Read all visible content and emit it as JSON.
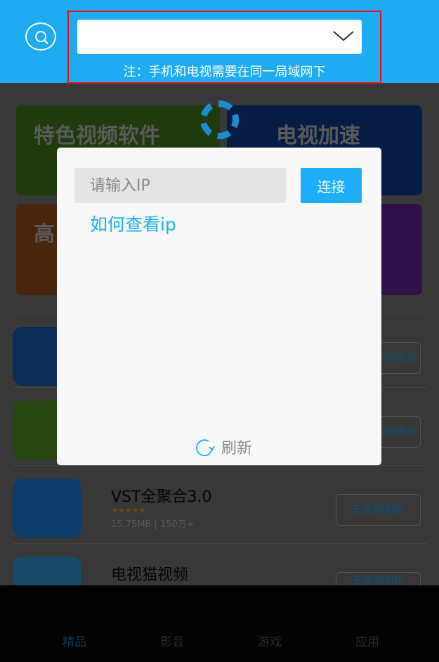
{
  "header": {
    "note": "注：手机和电视需要在同一局域网下",
    "device_select_value": "",
    "icons": {
      "search": "search-icon",
      "dropdown": "chevron-down-icon"
    }
  },
  "banners": [
    {
      "title": "特色视频软件"
    },
    {
      "title": "电视加速"
    },
    {
      "title": "高"
    },
    {
      "title": ""
    }
  ],
  "apps": [
    {
      "name": "",
      "install": "安装到电视"
    },
    {
      "name": "",
      "install": "安装到电视"
    },
    {
      "name": "VST全聚合3.0",
      "size": "15.75MB",
      "downloads": "150万+",
      "rating": 4.5,
      "install": "安装到电视"
    },
    {
      "name": "电视猫视频",
      "install": "安装到电视"
    }
  ],
  "bottom_nav": [
    "精品",
    "影音",
    "游戏",
    "应用"
  ],
  "dialog": {
    "ip_placeholder": "请输入IP",
    "connect": "连接",
    "howto": "如何查看ip",
    "refresh": "刷新"
  },
  "colors": {
    "accent": "#1eabf2",
    "highlight_box": "#e8141c"
  }
}
